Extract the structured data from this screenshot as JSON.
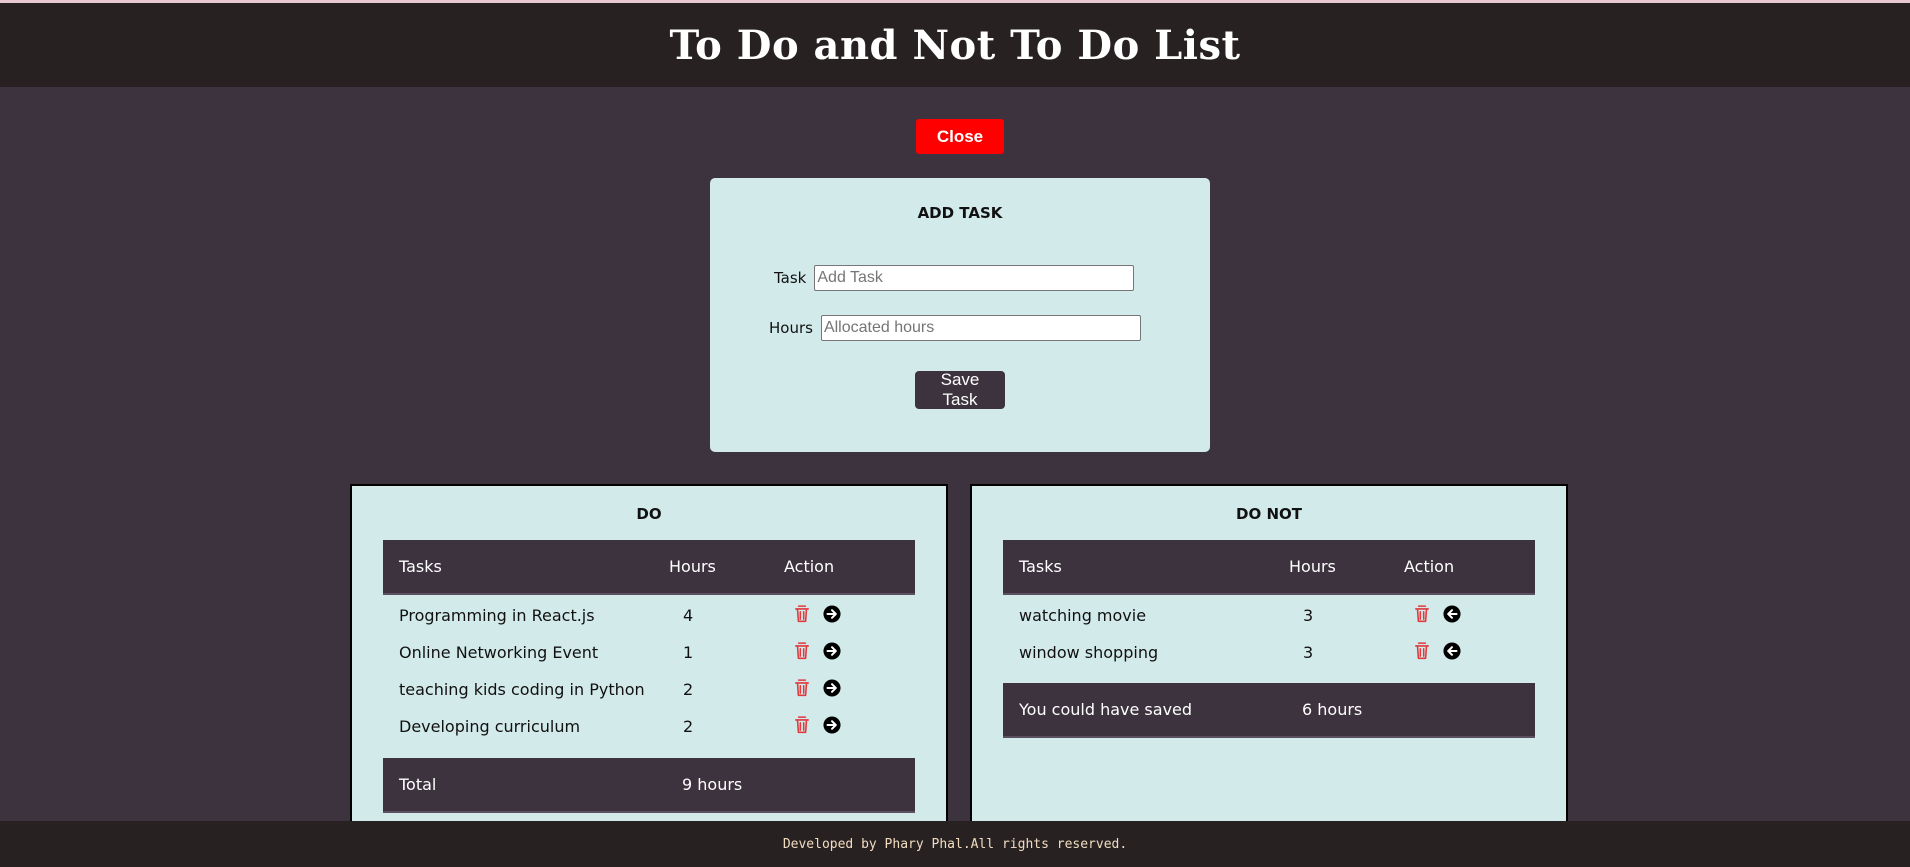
{
  "app": {
    "title": "To Do and Not To Do List"
  },
  "close_button": {
    "label": "Close"
  },
  "add_task": {
    "title": "ADD TASK",
    "task_label": "Task",
    "task_placeholder": "Add Task",
    "task_value": "",
    "hours_label": "Hours",
    "hours_placeholder": "Allocated hours",
    "hours_value": "",
    "save_label": "Save Task"
  },
  "do_list": {
    "title": "DO",
    "headers": {
      "tasks": "Tasks",
      "hours": "Hours",
      "action": "Action"
    },
    "rows": [
      {
        "task": "Programming in React.js",
        "hours": "4"
      },
      {
        "task": "Online Networking Event",
        "hours": "1"
      },
      {
        "task": "teaching kids coding in Python",
        "hours": "2"
      },
      {
        "task": "Developing curriculum",
        "hours": "2"
      }
    ],
    "footer": {
      "label": "Total",
      "value": "9 hours"
    },
    "row_icons": [
      "trash-icon",
      "arrow-right-circle-icon"
    ]
  },
  "do_not_list": {
    "title": "DO NOT",
    "headers": {
      "tasks": "Tasks",
      "hours": "Hours",
      "action": "Action"
    },
    "rows": [
      {
        "task": "watching movie",
        "hours": "3"
      },
      {
        "task": "window shopping",
        "hours": "3"
      }
    ],
    "footer": {
      "label": "You could have saved",
      "value": "6 hours"
    },
    "row_icons": [
      "trash-icon",
      "arrow-left-circle-icon"
    ]
  },
  "footer": {
    "text": "Developed by Phary Phal.All rights reserved."
  },
  "colors": {
    "background": "#3d333e",
    "header": "#272122",
    "card": "#d3eaea",
    "danger": "#ff0000",
    "trash": "#e0393e"
  }
}
